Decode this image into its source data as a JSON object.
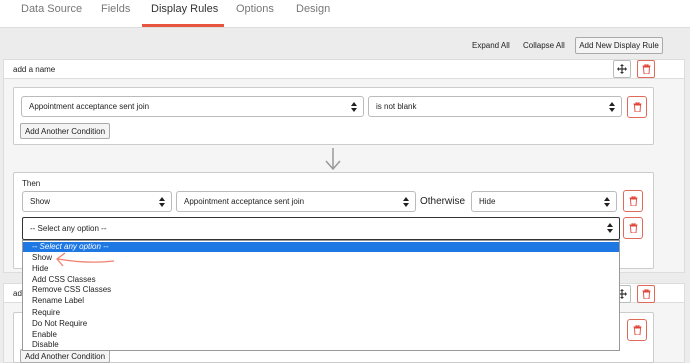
{
  "tabs": [
    {
      "label": "Data Source"
    },
    {
      "label": "Fields"
    },
    {
      "label": "Display Rules"
    },
    {
      "label": "Options"
    },
    {
      "label": "Design"
    }
  ],
  "toolbar": {
    "expand_all": "Expand All",
    "collapse_all": "Collapse All",
    "add_rule": "Add New Display Rule"
  },
  "rule1": {
    "name": "add a name",
    "condition": {
      "field": "Appointment acceptance sent join",
      "operator": "is not blank"
    },
    "add_condition": "Add Another Condition",
    "then_label": "Then",
    "action": "Show",
    "action_field": "Appointment acceptance sent join",
    "otherwise_label": "Otherwise",
    "otherwise_action": "Hide",
    "new_action": "-- Select any option --"
  },
  "rule2": {
    "name_partial": "ad",
    "add_condition": "Add Another Condition"
  },
  "dropdown": {
    "options": [
      "-- Select any option --",
      "Show",
      "Hide",
      "Add CSS Classes",
      "Remove CSS Classes",
      "Rename Label",
      "Require",
      "Do Not Require",
      "Enable",
      "Disable"
    ],
    "selected_index": 0
  },
  "colors": {
    "accent": "#e8553e",
    "selected": "#1e78e4",
    "annotation": "#f08070"
  },
  "icons": {
    "move": "move-arrows-icon",
    "delete": "trash-icon",
    "connector": "down-arrow-icon"
  }
}
